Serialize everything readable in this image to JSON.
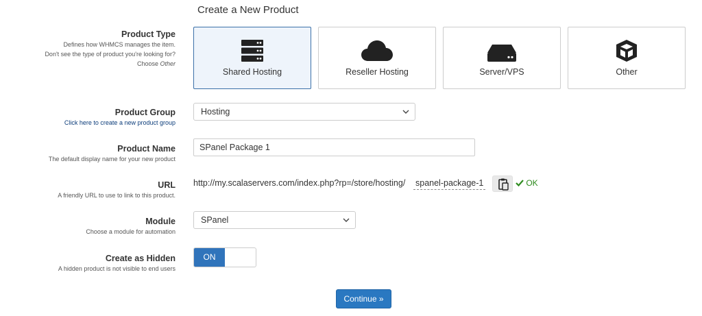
{
  "page_title": "Create a New Product",
  "product_type": {
    "label": "Product Type",
    "help_line1": "Defines how WHMCS manages the item.",
    "help_line2": "Don't see the type of product you're looking for?",
    "help_line3_prefix": "Choose ",
    "help_line3_em": "Other",
    "selected": "Shared Hosting",
    "options": [
      {
        "label": "Shared Hosting",
        "icon": "server-stack-icon"
      },
      {
        "label": "Reseller Hosting",
        "icon": "cloud-icon"
      },
      {
        "label": "Server/VPS",
        "icon": "hard-drive-icon"
      },
      {
        "label": "Other",
        "icon": "cube-icon"
      }
    ]
  },
  "product_group": {
    "label": "Product Group",
    "help_link": "Click here to create a new product group",
    "value": "Hosting"
  },
  "product_name": {
    "label": "Product Name",
    "help": "The default display name for your new product",
    "value": "SPanel Package 1"
  },
  "url": {
    "label": "URL",
    "help": "A friendly URL to use to link to this product.",
    "prefix": "http://my.scalaservers.com/index.php?rp=/store/hosting/",
    "slug": "spanel-package-1",
    "status": "OK"
  },
  "module": {
    "label": "Module",
    "help": "Choose a module for automation",
    "value": "SPanel"
  },
  "create_hidden": {
    "label": "Create as Hidden",
    "help": "A hidden product is not visible to end users",
    "state": "ON"
  },
  "continue_label": "Continue »",
  "colors": {
    "primary": "#2a78c1",
    "toggle_on": "#3074bb",
    "ok": "#2e8b1e",
    "active_card_bg": "#eef4fb"
  }
}
